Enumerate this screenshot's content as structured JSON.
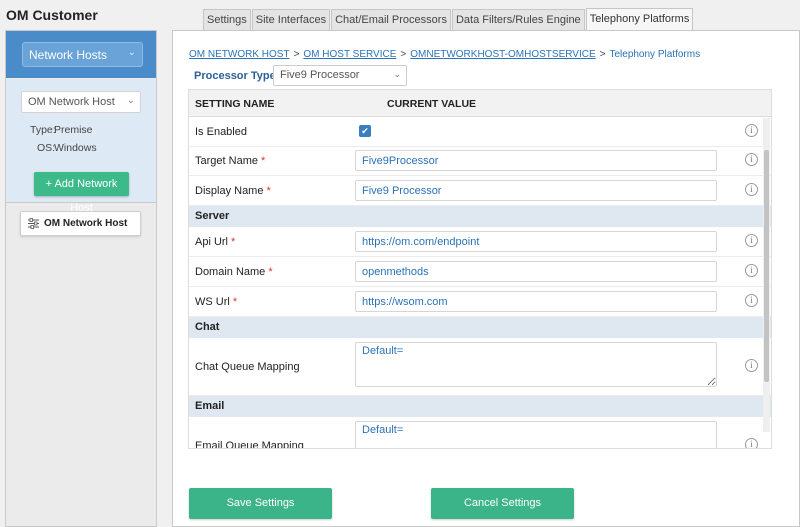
{
  "app": {
    "title": "OM Customer"
  },
  "sidebar": {
    "hosts_dropdown": "Network Hosts",
    "host_dropdown": "OM Network Host",
    "type_label": "Type:",
    "type_value": "Premise",
    "os_label": "OS:",
    "os_value": "Windows",
    "add_button": "+ Add Network Host",
    "host_item": "OM Network Host"
  },
  "tabs": [
    {
      "label": "Settings"
    },
    {
      "label": "Site Interfaces"
    },
    {
      "label": "Chat/Email Processors"
    },
    {
      "label": "Data Filters/Rules Engine"
    },
    {
      "label": "Telephony Platforms",
      "active": true
    }
  ],
  "breadcrumb": {
    "items": [
      "OM NETWORK HOST",
      "OM HOST SERVICE",
      "OMNETWORKHOST-OMHOSTSERVICE"
    ],
    "separator": ">",
    "current": "Telephony Platforms"
  },
  "processor": {
    "label": "Processor Type :",
    "value": "Five9 Processor"
  },
  "grid": {
    "headers": {
      "setting": "SETTING NAME",
      "value": "CURRENT VALUE"
    },
    "enabled_label": "Is Enabled",
    "enabled": true,
    "target_name": {
      "label": "Target Name",
      "value": "Five9Processor"
    },
    "display_name": {
      "label": "Display Name",
      "value": "Five9 Processor"
    },
    "sections": {
      "server": "Server",
      "chat": "Chat",
      "email": "Email"
    },
    "api_url": {
      "label": "Api Url",
      "value": "https://om.com/endpoint"
    },
    "domain_name": {
      "label": "Domain Name",
      "value": "openmethods"
    },
    "ws_url": {
      "label": "WS Url",
      "value": "https://wsom.com"
    },
    "chat_queue": {
      "label": "Chat Queue Mapping",
      "value": "Default="
    },
    "email_queue": {
      "label": "Email Queue Mapping",
      "value": "Default="
    },
    "required_mark": "*",
    "info_glyph": "i"
  },
  "buttons": {
    "save": "Save Settings",
    "cancel": "Cancel Settings"
  },
  "colors": {
    "primary": "#4a8bc9",
    "accent": "#3cb48a",
    "link": "#2b72b8"
  }
}
